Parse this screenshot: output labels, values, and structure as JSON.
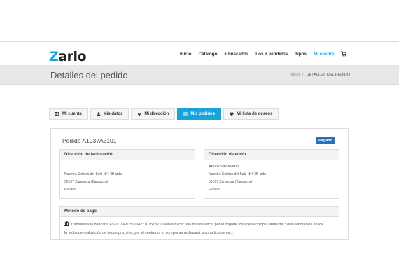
{
  "header": {
    "logo_prefix": "Z",
    "logo_rest": "arlo",
    "nav": [
      "Inicio",
      "Catálogo",
      "+ buscados",
      "Los + vendidos",
      "Tipos",
      "Mi cuenta"
    ],
    "active_nav": "Mi cuenta"
  },
  "titlebar": {
    "title": "Detalles del pedido",
    "breadcrumb_home": "Inicio",
    "breadcrumb_sep": "/",
    "breadcrumb_current": "DETALLES DEL PEDIDO"
  },
  "tabs": [
    {
      "label": "Mi cuenta",
      "icon": "grid-icon"
    },
    {
      "label": "Mis datos",
      "icon": "user-icon"
    },
    {
      "label": "Mi dirección",
      "icon": "map-pin-icon"
    },
    {
      "label": "Mis pedidos",
      "icon": "list-icon"
    },
    {
      "label": "Mi lista de deseos",
      "icon": "heart-icon"
    }
  ],
  "active_tab": "Mis pedidos",
  "order": {
    "id_label": "Pedido A1937A3101",
    "status": "Pagado",
    "status_color": "#2d6db5"
  },
  "billing": {
    "title": "Dirección de facturación",
    "lines": [
      "Nuestra Señora del Salz Nº4 3B izda",
      "50197 Zaragoza (Zaragoza)",
      "España"
    ]
  },
  "shipping": {
    "title": "Dirección de envío",
    "name": "Arturo Saz Martín",
    "lines": [
      "Nuestra Señora del Salz Nº4 3B izda",
      "50197 Zaragoza (Zaragoza)",
      "España"
    ]
  },
  "payment": {
    "title": "Metodo de pago",
    "line1": "Transferencia bancaria ES18 0049150004271015132 1 Debes hacer una transferencia por el importe total de la compra antes de 3 días laborables desde",
    "line2": "la fecha de realización de la compra, sino, por el contrario, tu compra se rechazará automáticamente..."
  },
  "colors": {
    "accent": "#1aa3d9",
    "badge": "#2d6db5"
  }
}
